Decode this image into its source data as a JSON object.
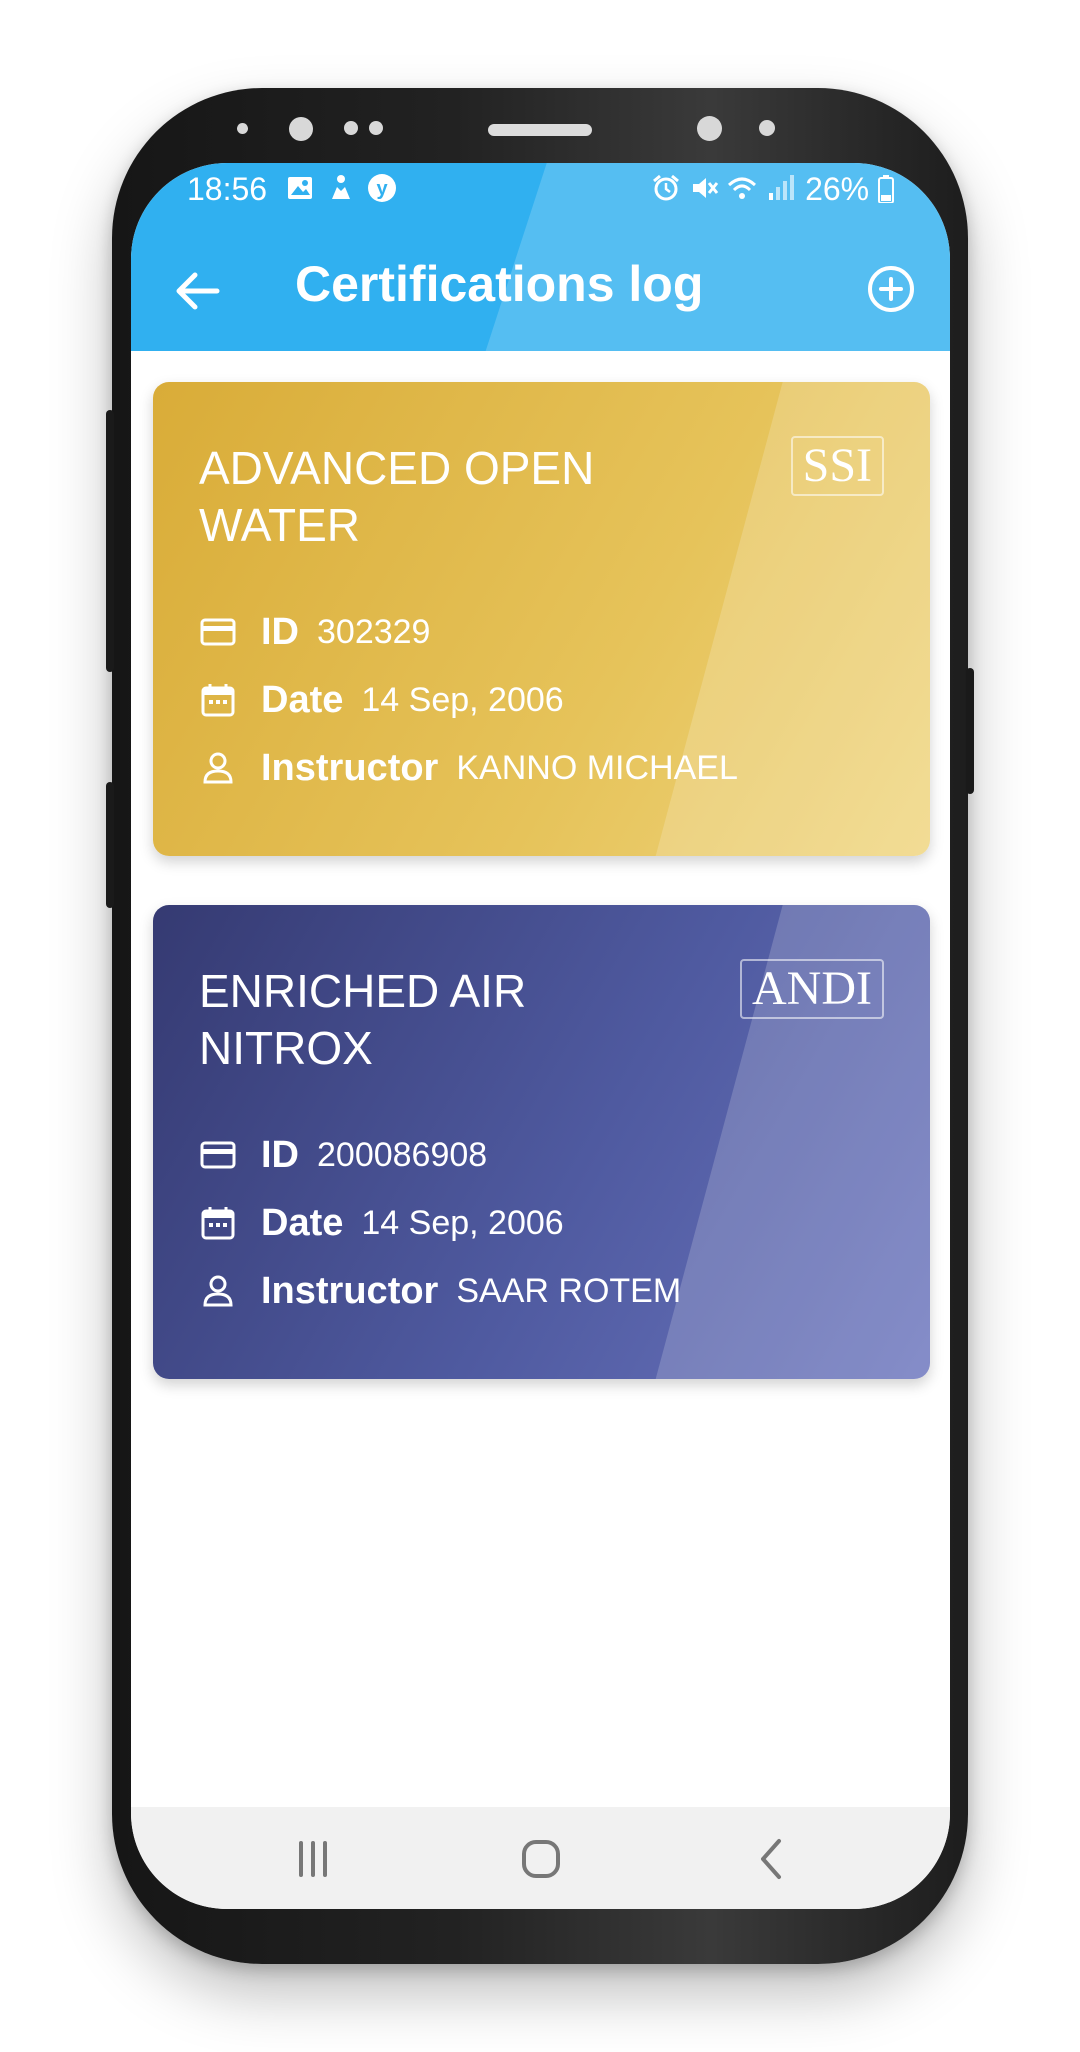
{
  "status_bar": {
    "time": "18:56",
    "left_icons": [
      "image-icon",
      "accessibility-icon",
      "y-app-icon"
    ],
    "right_icons": [
      "alarm-icon",
      "mute-icon",
      "wifi-icon",
      "signal-icon"
    ],
    "battery": "26%"
  },
  "app_bar": {
    "title": "Certifications log",
    "back_icon": "arrow-left-icon",
    "add_icon": "plus-circle-icon",
    "color": "#30b0f0"
  },
  "certifications": [
    {
      "name": "ADVANCED OPEN WATER",
      "agency": "SSI",
      "id_label": "ID",
      "id": "302329",
      "date_label": "Date",
      "date": "14 Sep, 2006",
      "instructor_label": "Instructor",
      "instructor": "KANNO MICHAEL",
      "color": "#e0b84a"
    },
    {
      "name": "ENRICHED AIR NITROX",
      "agency": "ANDI",
      "id_label": "ID",
      "id": "200086908",
      "date_label": "Date",
      "date": "14 Sep, 2006",
      "instructor_label": "Instructor",
      "instructor": "SAAR ROTEM",
      "color": "#4a5396"
    }
  ],
  "nav_bar": {
    "icons": [
      "recent-apps-icon",
      "home-icon",
      "back-icon"
    ]
  }
}
